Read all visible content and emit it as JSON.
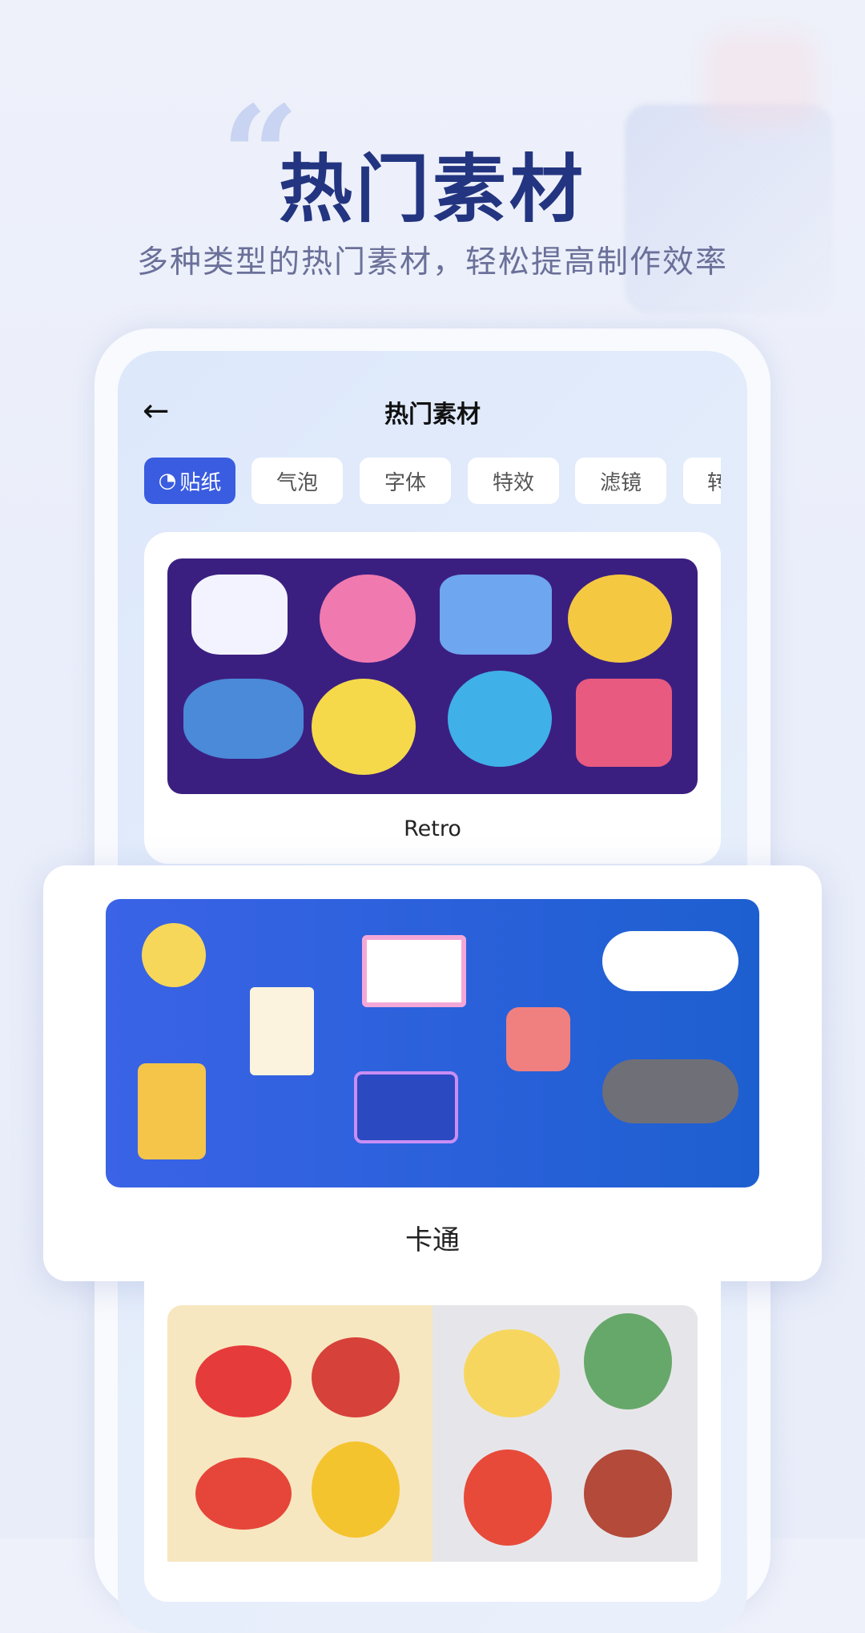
{
  "hero": {
    "quote_mark": "“",
    "title": "热门素材",
    "subtitle": "多种类型的热门素材，轻松提高制作效率"
  },
  "app": {
    "header": {
      "back_icon": "arrow-left-icon",
      "title": "热门素材"
    },
    "tabs": [
      {
        "label": "贴纸",
        "icon": "sticker-icon",
        "active": true
      },
      {
        "label": "气泡"
      },
      {
        "label": "字体"
      },
      {
        "label": "特效"
      },
      {
        "label": "滤镜"
      },
      {
        "label": "转"
      }
    ],
    "cards": [
      {
        "label": "Retro"
      },
      {
        "label": "卡通"
      },
      {
        "label": ""
      }
    ]
  },
  "colors": {
    "accent": "#3a5ce0",
    "title": "#233580",
    "retro_bg": "#3b1f80",
    "cartoon_bg": "#2f62e0"
  }
}
